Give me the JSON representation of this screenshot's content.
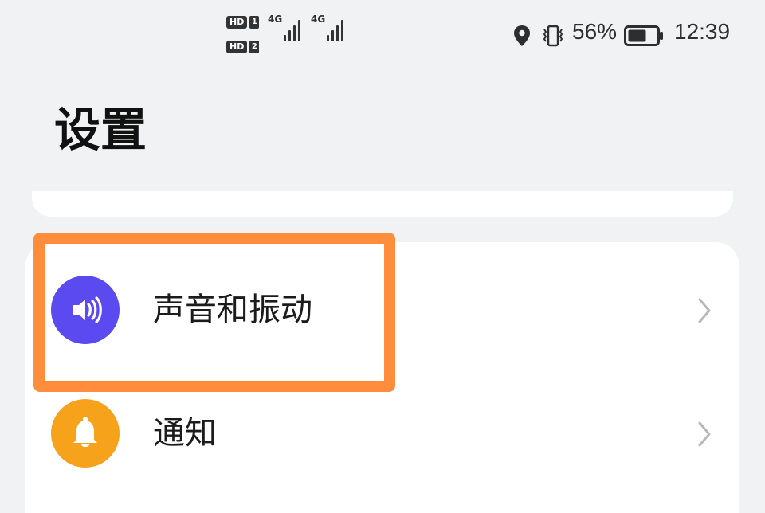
{
  "status_bar": {
    "sim1": {
      "hd_badge": "HD",
      "index": "1",
      "network": "4G"
    },
    "sim2": {
      "hd_badge": "HD",
      "index": "2",
      "network": "4G"
    },
    "battery_percent": "56%",
    "time": "12:39",
    "icons": [
      "location-icon",
      "vibrate-icon",
      "battery-icon"
    ],
    "icon_color": "#2e2e2e"
  },
  "page": {
    "title": "设置",
    "background": "#f1f2f4"
  },
  "settings": {
    "items": [
      {
        "label": "声音和振动",
        "icon": "speaker-icon",
        "icon_bg": "#5a4af0"
      },
      {
        "label": "通知",
        "icon": "bell-icon",
        "icon_bg": "#f6a21b"
      }
    ],
    "chevron_icon": "chevron-right-icon",
    "divider_color": "#d8d8d8"
  },
  "annotation": {
    "highlight_color": "#ff8d3b"
  }
}
